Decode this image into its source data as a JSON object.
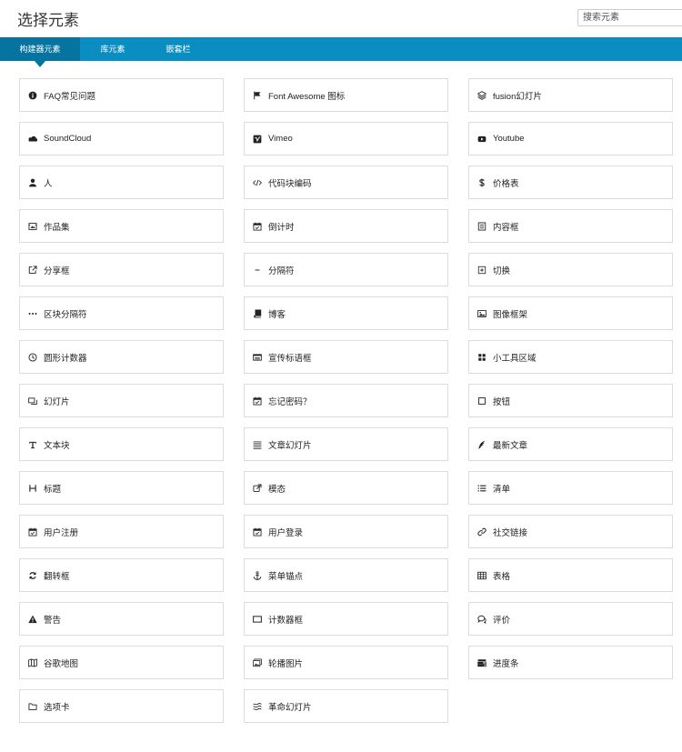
{
  "header": {
    "title": "选择元素",
    "search_placeholder": "搜索元素"
  },
  "tabs": [
    {
      "label": "构建器元素",
      "active": true
    },
    {
      "label": "库元素",
      "active": false
    },
    {
      "label": "嵌套栏",
      "active": false
    }
  ],
  "elements": [
    {
      "label": "FAQ常见问题",
      "icon": "info-icon"
    },
    {
      "label": "Font Awesome 图标",
      "icon": "flag-icon"
    },
    {
      "label": "fusion幻灯片",
      "icon": "layers-icon"
    },
    {
      "label": "SoundCloud",
      "icon": "soundcloud-icon"
    },
    {
      "label": "Vimeo",
      "icon": "vimeo-icon"
    },
    {
      "label": "Youtube",
      "icon": "youtube-icon"
    },
    {
      "label": "人",
      "icon": "person-icon"
    },
    {
      "label": "代码块编码",
      "icon": "code-icon"
    },
    {
      "label": "价格表",
      "icon": "dollar-icon"
    },
    {
      "label": "作品集",
      "icon": "portfolio-icon"
    },
    {
      "label": "倒计时",
      "icon": "calendar-icon"
    },
    {
      "label": "内容框",
      "icon": "content-box-icon"
    },
    {
      "label": "分享框",
      "icon": "share-icon"
    },
    {
      "label": "分隔符",
      "icon": "minus-icon"
    },
    {
      "label": "切换",
      "icon": "toggle-icon"
    },
    {
      "label": "区块分隔符",
      "icon": "ellipsis-icon"
    },
    {
      "label": "博客",
      "icon": "book-icon"
    },
    {
      "label": "图像框架",
      "icon": "image-icon"
    },
    {
      "label": "圆形计数器",
      "icon": "clock-icon"
    },
    {
      "label": "宣传标语框",
      "icon": "tagline-box-icon"
    },
    {
      "label": "小工具区域",
      "icon": "widget-icon"
    },
    {
      "label": "幻灯片",
      "icon": "slides-icon"
    },
    {
      "label": "忘记密码？",
      "icon": "calendar-icon"
    },
    {
      "label": "按钮",
      "icon": "square-icon"
    },
    {
      "label": "文本块",
      "icon": "text-icon"
    },
    {
      "label": "文章幻灯片",
      "icon": "stack-icon"
    },
    {
      "label": "最新文章",
      "icon": "feather-icon"
    },
    {
      "label": "标题",
      "icon": "heading-icon"
    },
    {
      "label": "模态",
      "icon": "external-link-icon"
    },
    {
      "label": "清单",
      "icon": "list-icon"
    },
    {
      "label": "用户注册",
      "icon": "calendar-icon"
    },
    {
      "label": "用户登录",
      "icon": "calendar-icon"
    },
    {
      "label": "社交链接",
      "icon": "link-icon"
    },
    {
      "label": "翻转框",
      "icon": "refresh-icon"
    },
    {
      "label": "菜单锚点",
      "icon": "anchor-icon"
    },
    {
      "label": "表格",
      "icon": "table-icon"
    },
    {
      "label": "警告",
      "icon": "warning-icon"
    },
    {
      "label": "计数器框",
      "icon": "counter-box-icon"
    },
    {
      "label": "评价",
      "icon": "comments-icon"
    },
    {
      "label": "谷歌地图",
      "icon": "map-icon"
    },
    {
      "label": "轮播图片",
      "icon": "images-icon"
    },
    {
      "label": "进度条",
      "icon": "progress-icon"
    },
    {
      "label": "选项卡",
      "icon": "folder-icon"
    },
    {
      "label": "革命幻灯片",
      "icon": "waves-icon"
    }
  ]
}
